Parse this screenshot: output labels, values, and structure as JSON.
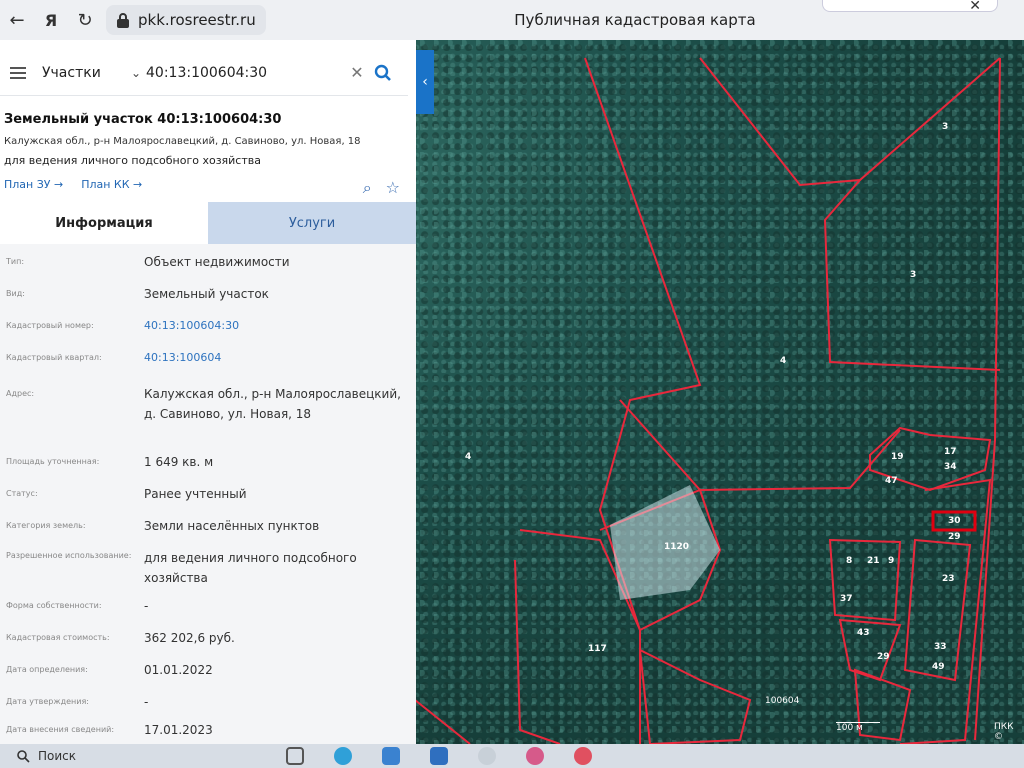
{
  "browser": {
    "yandex_label": "Я",
    "url": "pkk.rosreestr.ru",
    "title": "Публичная кадастровая карта"
  },
  "search": {
    "layer": "Участки",
    "query": "40:13:100604:30"
  },
  "card": {
    "title": "Земельный участок 40:13:100604:30",
    "address": "Калужская обл., р-н Малоярославецкий, д. Савиново, ул. Новая, 18",
    "use": "для ведения личного подсобного хозяйства",
    "links": [
      "План ЗУ →",
      "План КК →"
    ]
  },
  "tabs": [
    "Информация",
    "Услуги"
  ],
  "info": [
    {
      "label": "Тип:",
      "value": "Объект недвижимости"
    },
    {
      "label": "Вид:",
      "value": "Земельный участок"
    },
    {
      "label": "Кадастровый номер:",
      "value": "40:13:100604:30",
      "link": true
    },
    {
      "label": "Кадастровый квартал:",
      "value": "40:13:100604",
      "link": true
    },
    {
      "label": "Адрес:",
      "value": "Калужская обл., р-н Малоярославецкий, д. Савиново, ул. Новая, 18"
    },
    {
      "label": "Площадь уточненная:",
      "value": "1 649 кв. м"
    },
    {
      "label": "Статус:",
      "value": "Ранее учтенный"
    },
    {
      "label": "Категория земель:",
      "value": "Земли населённых пунктов"
    },
    {
      "label": "Разрешенное использование:",
      "value": "для ведения личного подсобного хозяйства"
    },
    {
      "label": "Форма собственности:",
      "value": "-"
    },
    {
      "label": "Кадастровая стоимость:",
      "value": "362 202,6 руб."
    },
    {
      "label": "Дата определения:",
      "value": "01.01.2022"
    },
    {
      "label": "Дата утверждения:",
      "value": "-"
    },
    {
      "label": "Дата внесения сведений:",
      "value": "17.01.2023"
    }
  ],
  "map_labels": [
    "3",
    "3",
    "4",
    "4",
    "1120",
    "117",
    "17",
    "19",
    "34",
    "47",
    "30",
    "29",
    "8",
    "21",
    "9",
    "23",
    "37",
    "43",
    "33",
    "29",
    "49",
    "100604",
    "100 м",
    "ПКК ©"
  ],
  "taskbar": {
    "search_label": "Поиск"
  }
}
